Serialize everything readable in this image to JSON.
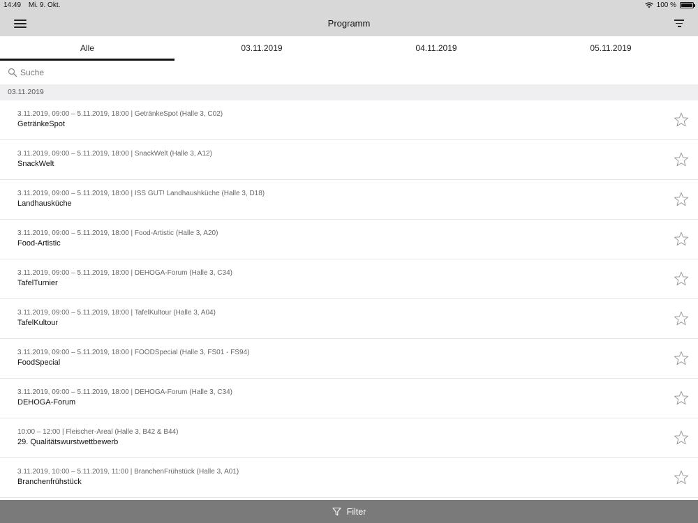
{
  "status": {
    "time": "14:49",
    "date": "Mi. 9. Okt.",
    "battery": "100 %",
    "battery_level": 1.0
  },
  "nav": {
    "title": "Programm"
  },
  "tabs": [
    {
      "label": "Alle",
      "active": true
    },
    {
      "label": "03.11.2019",
      "active": false
    },
    {
      "label": "04.11.2019",
      "active": false
    },
    {
      "label": "05.11.2019",
      "active": false
    }
  ],
  "search": {
    "placeholder": "Suche",
    "value": ""
  },
  "section": {
    "label": "03.11.2019"
  },
  "events": [
    {
      "meta": "3.11.2019, 09:00 – 5.11.2019, 18:00 | GetränkeSpot (Halle 3, C02)",
      "name": "GetränkeSpot"
    },
    {
      "meta": "3.11.2019, 09:00 – 5.11.2019, 18:00 | SnackWelt (Halle 3, A12)",
      "name": "SnackWelt"
    },
    {
      "meta": "3.11.2019, 09:00 – 5.11.2019, 18:00 | ISS GUT! Landhaushküche (Halle 3, D18)",
      "name": "Landhausküche"
    },
    {
      "meta": "3.11.2019, 09:00 – 5.11.2019, 18:00 | Food-Artistic (Halle 3, A20)",
      "name": "Food-Artistic"
    },
    {
      "meta": "3.11.2019, 09:00 – 5.11.2019, 18:00 | DEHOGA-Forum (Halle 3, C34)",
      "name": "TafelTurnier"
    },
    {
      "meta": "3.11.2019, 09:00 – 5.11.2019, 18:00 | TafelKultour (Halle 3, A04)",
      "name": "TafelKultour"
    },
    {
      "meta": "3.11.2019, 09:00 – 5.11.2019, 18:00 | FOODSpecial (Halle 3, FS01 - FS94)",
      "name": "FoodSpecial"
    },
    {
      "meta": "3.11.2019, 09:00 – 5.11.2019, 18:00 | DEHOGA-Forum (Halle 3, C34)",
      "name": "DEHOGA-Forum"
    },
    {
      "meta": "10:00 – 12:00 | Fleischer-Areal (Halle 3, B42 & B44)",
      "name": "29. Qualitätswurstwettbewerb"
    },
    {
      "meta": "3.11.2019, 10:00 – 5.11.2019, 11:00 | BranchenFrühstück (Halle 3, A01)",
      "name": "Branchenfrühstück"
    }
  ],
  "bottom": {
    "filter_label": "Filter"
  }
}
